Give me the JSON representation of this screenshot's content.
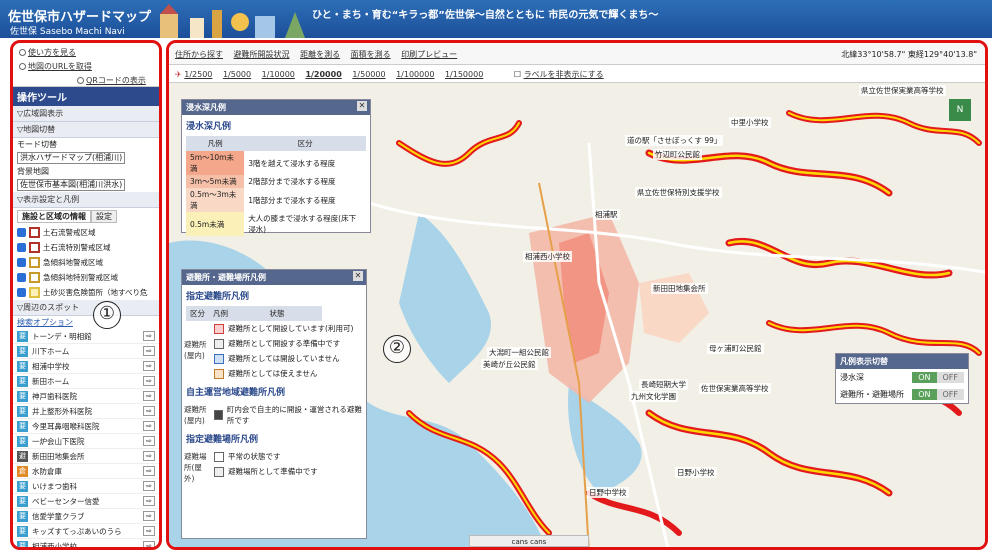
{
  "header": {
    "title": "佐世保市ハザードマップ",
    "subtitle": "佐世保 Sasebo Machi Navi",
    "slogan": "ひと・まち・育む“キラっ都”佐世保～自然とともに 市民の元気で輝くまち～"
  },
  "left": {
    "tools": [
      "使い方を見る",
      "地図のURLを取得",
      "QRコードの表示"
    ],
    "ops_title": "操作ツール",
    "sections": {
      "wide": "▽広域図表示",
      "switch": "▽地図切替",
      "display": "▽表示設定と凡例",
      "spots": "▽周辺のスポット"
    },
    "mode_label": "モード切替",
    "mode_value": "洪水ハザードマップ(相浦川)",
    "bg_label": "背景地図",
    "bg_value": "佐世保市基本図(相浦川洪水)",
    "tab_info": "施設と区域の情報",
    "tab_settings": "設定",
    "legend_items": [
      "土石流警戒区域",
      "土石流特別警戒区域",
      "急傾斜地警戒区域",
      "急傾斜地特別警戒区域",
      "土砂災害危険箇所（地すべり危"
    ],
    "search_option": "検索オプション",
    "spots": [
      "トーンデ・明相館",
      "川下ホーム",
      "相浦中学校",
      "新田ホーム",
      "神戸歯科医院",
      "井上整形外科医院",
      "今里耳鼻咽喉科医院",
      "一炉会山下医院",
      "新田田地集会所",
      "水防倉庫",
      "いけまつ歯科",
      "ベビーセンター信愛",
      "信愛学童クラブ",
      "キッズすてっぷあいのうら",
      "相浦西小学校"
    ],
    "marker": "①"
  },
  "map": {
    "toolbar": [
      "住所から探す",
      "避難所開設状況",
      "距離を測る",
      "面積を測る",
      "印刷プレビュー"
    ],
    "coords": "北緯33°10'58.7\" 東経129°40'13.8\"",
    "scales": [
      "1/2500",
      "1/5000",
      "1/10000",
      "1/20000",
      "1/50000",
      "1/100000",
      "1/150000"
    ],
    "current_scale": "1/20000",
    "labels_toggle": "ラベルを非表示にする",
    "marker": "②",
    "north": "N"
  },
  "flood_legend": {
    "window_title": "浸水深凡例",
    "title": "浸水深凡例",
    "col_legend": "凡例",
    "col_class": "区分",
    "rows": [
      {
        "depth": "5m～10m未満",
        "desc": "3階を越えて浸水する程度",
        "color": "#f4a78a"
      },
      {
        "depth": "3m～5m未満",
        "desc": "2階部分まで浸水する程度",
        "color": "#f6c0a8"
      },
      {
        "depth": "0.5m～3m未満",
        "desc": "1階部分まで浸水する程度",
        "color": "#fad8c6"
      },
      {
        "depth": "0.5m未満",
        "desc": "大人の膝まで浸水する程度(床下浸水)",
        "color": "#fbf0b8"
      }
    ]
  },
  "evac_legend": {
    "window_title": "避難所・避難場所凡例",
    "section1": "指定避難所凡例",
    "col_class": "区分",
    "col_legend": "凡例",
    "col_state": "状態",
    "row_label": "避難所(屋内)",
    "items1": [
      "避難所として開設しています(利用可)",
      "避難所として開設する準備中です",
      "避難所としては開設していません",
      "避難所としては使えません"
    ],
    "section2": "自主運営地域避難所凡例",
    "row_label2": "避難所(屋内)",
    "items2": [
      "町内会で自主的に開設・運営される避難所です"
    ],
    "section3": "指定避難場所凡例",
    "row_label3": "避難場所(屋外)",
    "items3": [
      "平常の状態です",
      "避難場所として準備中です"
    ]
  },
  "toggle": {
    "title": "凡例表示切替",
    "rows": [
      {
        "label": "浸水深",
        "on": "ON",
        "off": "OFF"
      },
      {
        "label": "避難所・避難場所",
        "on": "ON",
        "off": "OFF"
      }
    ]
  },
  "map_labels": [
    "中里小学校",
    "道の駅「させぼっくす 99」",
    "竹辺町公民館",
    "県立佐世保特別支援学校",
    "相浦西小学校",
    "新田田地集会所",
    "大潟町一組公民館",
    "美崎が丘公民館",
    "母ヶ浦町公民館",
    "長崎短期大学",
    "佐世保実業高等学校",
    "九州文化学園",
    "日野小学校",
    "日野中学校",
    "県立佐世保実業高等学校",
    "相浦駅"
  ],
  "bottom_bar": "cans cans"
}
